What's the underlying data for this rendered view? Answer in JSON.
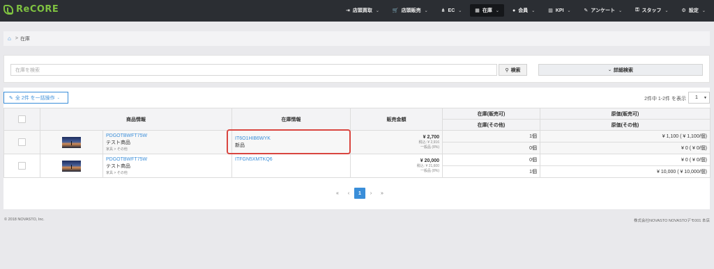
{
  "app": {
    "logo_text": "ReCORE"
  },
  "nav": {
    "items": [
      {
        "label": "店頭買取",
        "icon": "sign-in-icon",
        "glyph": "⇥"
      },
      {
        "label": "店頭販売",
        "icon": "cart-icon",
        "glyph": "🛒"
      },
      {
        "label": "EC",
        "icon": "sitemap-icon",
        "glyph": "⋔"
      },
      {
        "label": "在庫",
        "icon": "cubes-icon",
        "glyph": "▦"
      },
      {
        "label": "会員",
        "icon": "user-icon",
        "glyph": "●"
      },
      {
        "label": "KPI",
        "icon": "chart-icon",
        "glyph": "▥"
      },
      {
        "label": "アンケート",
        "icon": "edit-icon",
        "glyph": "✎"
      },
      {
        "label": "スタッフ",
        "icon": "lock-icon",
        "glyph": "⚿"
      },
      {
        "label": "設定",
        "icon": "gear-icon",
        "glyph": "⚙"
      }
    ]
  },
  "breadcrumb": {
    "home_icon": "home-icon",
    "separator": ">",
    "current": "在庫"
  },
  "search": {
    "placeholder": "在庫を検索",
    "button_label": "検索",
    "advanced_label": "詳細検索"
  },
  "toolbar": {
    "bulk_label": "全 2件 を一括操作",
    "paging_info": "2件中 1-2件 を表示",
    "per_page": "1"
  },
  "table": {
    "headers": {
      "product": "商品情報",
      "stock_info": "在庫情報",
      "price": "販売金額",
      "stock_sale": "在庫(販売可)",
      "stock_other": "在庫(その他)",
      "cost_sale": "原価(販売可)",
      "cost_other": "原価(その他)"
    },
    "rows": [
      {
        "product_code": "PDGOTBWFT75W",
        "product_name": "テスト商品",
        "category": "家具 > その他",
        "stock_code": "IT6O1HIB6WYK",
        "condition": "新品",
        "price": "¥ 2,700",
        "tax_incl": "税込: ¥ 2,916",
        "tax_type": "一般品 (8%)",
        "stock_sale": "1個",
        "stock_other": "0個",
        "cost_sale": "¥ 1,100 ( ¥ 1,100/個)",
        "cost_other": "¥ 0 ( ¥ 0/個)"
      },
      {
        "product_code": "PDGOTBWFT75W",
        "product_name": "テスト商品",
        "category": "家具 > その他",
        "stock_code": "ITFGN5XMTKQ6",
        "condition": "",
        "price": "¥ 20,000",
        "tax_incl": "税込: ¥ 21,600",
        "tax_type": "一般品 (8%)",
        "stock_sale": "0個",
        "stock_other": "1個",
        "cost_sale": "¥ 0 ( ¥ 0/個)",
        "cost_other": "¥ 10,000 ( ¥ 10,000/個)"
      }
    ]
  },
  "pagination": {
    "first": "«",
    "prev": "‹",
    "current": "1",
    "next": "›",
    "last": "»"
  },
  "footer": {
    "copyright": "© 2018 NOVASTO, Inc.",
    "store": "株式会社NOVASTO NOVASTOデモ001 本店"
  },
  "colors": {
    "accent": "#3a8ed9",
    "brand": "#7fc241",
    "highlight": "#d9453f",
    "topbar": "#2b2e33"
  }
}
